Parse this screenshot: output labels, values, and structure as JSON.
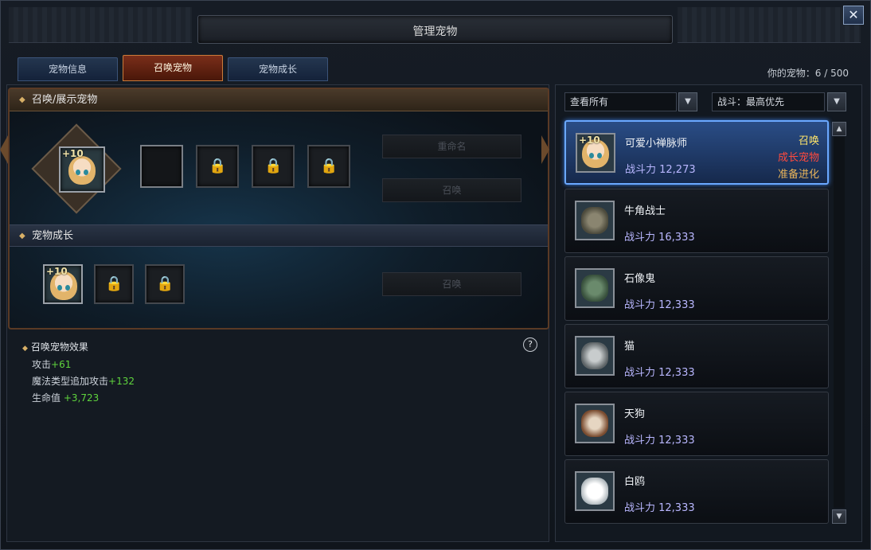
{
  "window": {
    "title": "管理宠物",
    "close_label": "✕"
  },
  "tabs": [
    {
      "label": "宠物信息",
      "active": false
    },
    {
      "label": "召唤宠物",
      "active": true
    },
    {
      "label": "宠物成长",
      "active": false
    }
  ],
  "pet_count": "你的宠物：6 / 500",
  "summon_section": {
    "title": "召唤/展示宠物",
    "badge": "+10",
    "rename_label": "重命名",
    "summon_label": "召唤"
  },
  "growth_section": {
    "title": "宠物成长",
    "badge": "+10",
    "summon_label": "召唤"
  },
  "effects": {
    "title": "召唤宠物效果",
    "rows": [
      {
        "label": "攻击",
        "value": "+61"
      },
      {
        "label": "魔法类型追加攻击",
        "value": "+132"
      },
      {
        "label": "生命值 ",
        "value": "+3,723"
      }
    ],
    "help_label": "?"
  },
  "filters": {
    "view": "查看所有",
    "sort": "战斗：最高优先"
  },
  "pets": [
    {
      "name": "可爱小禅脉师",
      "power": "战斗力 12,273",
      "badge": "+10",
      "tags": [
        "召唤",
        "成长宠物",
        "准备进化"
      ],
      "selected": true,
      "color": "#e2b46a"
    },
    {
      "name": "牛角战士",
      "power": "战斗力 16,333",
      "badge": "",
      "tags": [],
      "selected": false,
      "color": "#6b6a5a"
    },
    {
      "name": "石像鬼",
      "power": "战斗力 12,333",
      "badge": "",
      "tags": [],
      "selected": false,
      "color": "#4e6b52"
    },
    {
      "name": "猫",
      "power": "战斗力 12,333",
      "badge": "",
      "tags": [],
      "selected": false,
      "color": "#8d9396"
    },
    {
      "name": "天狗",
      "power": "战斗力 12,333",
      "badge": "",
      "tags": [],
      "selected": false,
      "color": "#8a5a3c"
    },
    {
      "name": "白鸥",
      "power": "战斗力 12,333",
      "badge": "",
      "tags": [],
      "selected": false,
      "color": "#dfe4e8"
    }
  ],
  "icons": {
    "close": "close-icon",
    "help": "question-icon",
    "lock": "lock-icon",
    "dropdown": "triangle-down-icon",
    "scroll_up": "triangle-up-icon",
    "scroll_down": "triangle-down-icon"
  }
}
